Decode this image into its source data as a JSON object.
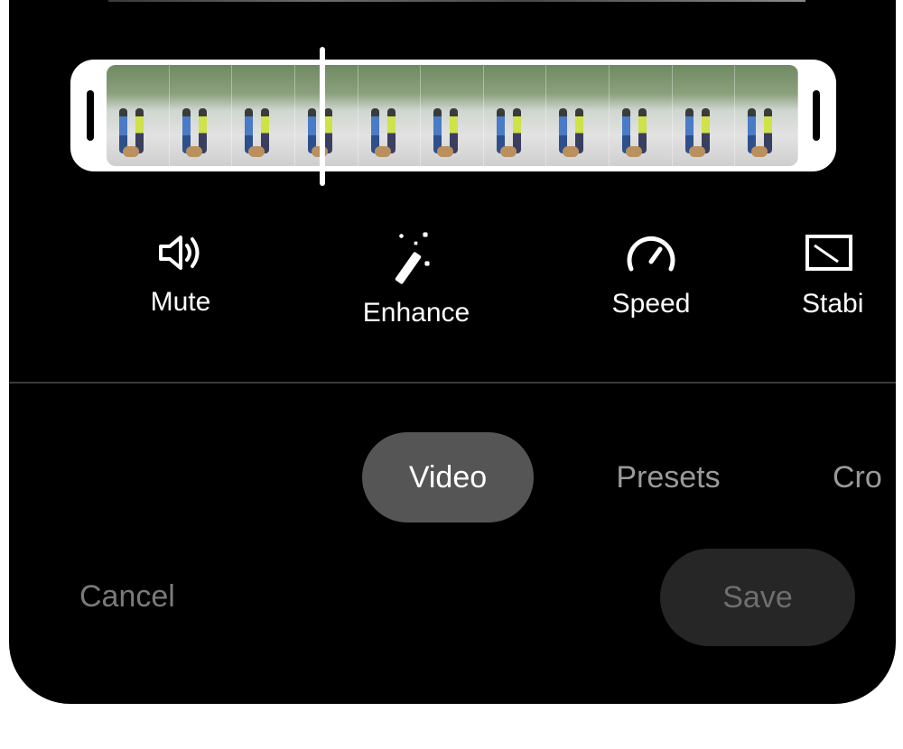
{
  "tools": [
    {
      "label": "Mute",
      "icon": "speaker-icon"
    },
    {
      "label": "Enhance",
      "icon": "magic-wand-icon"
    },
    {
      "label": "Speed",
      "icon": "speedometer-icon"
    },
    {
      "label": "Stabi",
      "icon": "stabilize-icon"
    }
  ],
  "tabs": [
    {
      "label": "Video",
      "selected": true
    },
    {
      "label": "Presets",
      "selected": false
    },
    {
      "label": "Cro",
      "selected": false
    }
  ],
  "actions": {
    "cancel": "Cancel",
    "save": "Save"
  },
  "colors": {
    "background": "#000000",
    "selected_tab": "#555555",
    "save_button": "#262626",
    "inactive_text": "#9a9a9a"
  }
}
